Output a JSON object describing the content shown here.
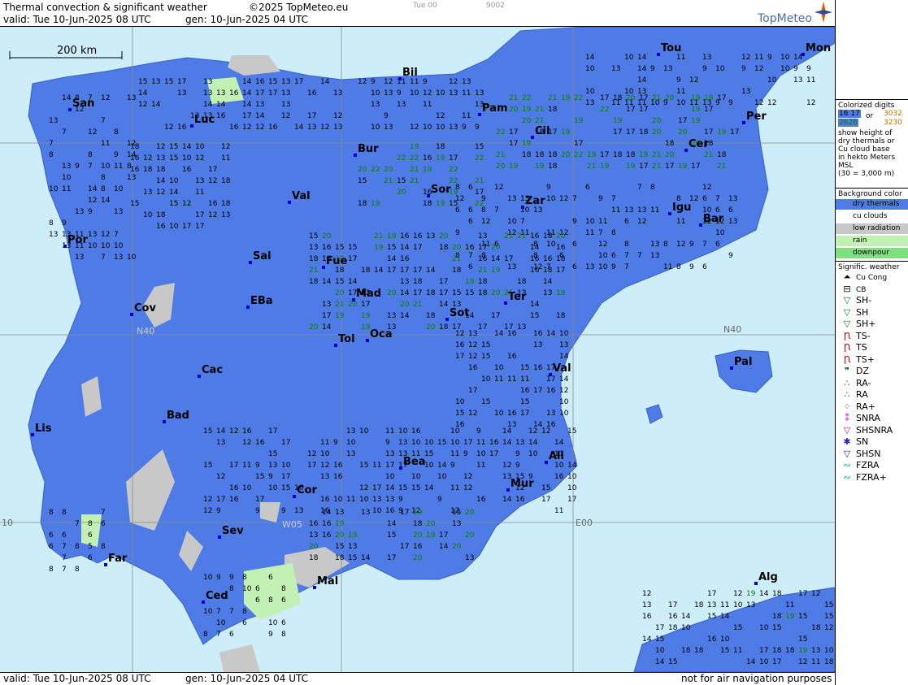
{
  "header": {
    "title": "Thermal convection & significant weather",
    "copyright": "©2025 TopMeteo.eu",
    "step_label": "Tue 00",
    "code": "9002",
    "valid": "valid:  Tue  10-Jun-2025  08 UTC",
    "gen": "gen: 10-Jun-2025 04 UTC"
  },
  "footer": {
    "valid": "valid:  Tue  10-Jun-2025  08 UTC",
    "gen": "gen: 10-Jun-2025 04 UTC",
    "note": "not for air navigation purposes"
  },
  "brand": {
    "name": "TopMeteo"
  },
  "scale_label": "200 km",
  "grid_labels": {
    "n40_left": "N40",
    "n40_right": "N40",
    "w05": "W05",
    "e00": "E00",
    "w10": "10"
  },
  "cities": [
    {
      "name": "San"
    },
    {
      "name": "Luc"
    },
    {
      "name": "Bil"
    },
    {
      "name": "Pam"
    },
    {
      "name": "Tou"
    },
    {
      "name": "Mon"
    },
    {
      "name": "Per"
    },
    {
      "name": "Cil"
    },
    {
      "name": "Bur"
    },
    {
      "name": "Cer"
    },
    {
      "name": "Val"
    },
    {
      "name": "Sor"
    },
    {
      "name": "Zar"
    },
    {
      "name": "Igu"
    },
    {
      "name": "Bar"
    },
    {
      "name": "Por"
    },
    {
      "name": "Sal"
    },
    {
      "name": "Fue"
    },
    {
      "name": "Mad"
    },
    {
      "name": "Cov"
    },
    {
      "name": "EBa"
    },
    {
      "name": "Sot"
    },
    {
      "name": "Ter"
    },
    {
      "name": "Tol"
    },
    {
      "name": "Oca"
    },
    {
      "name": "Pal"
    },
    {
      "name": "Cac"
    },
    {
      "name": "Val"
    },
    {
      "name": "Bad"
    },
    {
      "name": "Lis"
    },
    {
      "name": "Ali"
    },
    {
      "name": "Bea"
    },
    {
      "name": "Cor"
    },
    {
      "name": "Mur"
    },
    {
      "name": "Sev"
    },
    {
      "name": "Far"
    },
    {
      "name": "Mal"
    },
    {
      "name": "Ced"
    },
    {
      "name": "Alg"
    }
  ],
  "legend": {
    "digits_title": "Colorized digits",
    "digits_sample_blue": "16 17",
    "digits_or": "or",
    "digits_sample_orange": "3032",
    "digits_sample_green": "2626",
    "digits_sample_orange2": "3230",
    "digits_desc": [
      "show height of",
      "dry thermals or",
      "Cu cloud base",
      "in hekto Meters",
      "MSL",
      "(30 = 3,000 m)"
    ],
    "bg_title": "Background color",
    "bg_items": [
      {
        "label": "dry thermals",
        "color": "#4f7be6"
      },
      {
        "label": "cu clouds",
        "color": "#ffffff"
      },
      {
        "label": "low radiation",
        "color": "#c8c8c8"
      },
      {
        "label": "rain",
        "color": "#c3f0b4"
      },
      {
        "label": "downpour",
        "color": "#7ee07e"
      }
    ],
    "wx_title": "Signific. weather",
    "wx_items": [
      {
        "label": "Cu Cong",
        "icon": "cu-cong-icon",
        "glyph": "⏶",
        "color": "#000"
      },
      {
        "label": "CB",
        "icon": "cb-icon",
        "glyph": "⊟",
        "color": "#000"
      },
      {
        "label": "SH-",
        "icon": "shower-light-icon",
        "glyph": "▽",
        "color": "#0a7d0a"
      },
      {
        "label": "SH",
        "icon": "shower-icon",
        "glyph": "▽",
        "color": "#0a7d0a"
      },
      {
        "label": "SH+",
        "icon": "shower-heavy-icon",
        "glyph": "▽",
        "color": "#0a7d0a"
      },
      {
        "label": "TS-",
        "icon": "thunderstorm-light-icon",
        "glyph": "Ꞃ",
        "color": "#d00000"
      },
      {
        "label": "TS",
        "icon": "thunderstorm-icon",
        "glyph": "Ꞃ",
        "color": "#d00000"
      },
      {
        "label": "TS+",
        "icon": "thunderstorm-heavy-icon",
        "glyph": "Ꞃ",
        "color": "#d00000"
      },
      {
        "label": "DZ",
        "icon": "drizzle-icon",
        "glyph": "❞",
        "color": "#0a5a0a"
      },
      {
        "label": "RA-",
        "icon": "rain-light-icon",
        "glyph": "∴",
        "color": "#0a5a0a"
      },
      {
        "label": "RA",
        "icon": "rain-icon",
        "glyph": "∴",
        "color": "#0a5a0a"
      },
      {
        "label": "RA+",
        "icon": "rain-heavy-icon",
        "glyph": "⁘",
        "color": "#0a5a0a"
      },
      {
        "label": "SNRA",
        "icon": "snow-rain-icon",
        "glyph": "⁑",
        "color": "#d000d0"
      },
      {
        "label": "SHSNRA",
        "icon": "snow-rain-shower-icon",
        "glyph": "▽",
        "color": "#d000d0"
      },
      {
        "label": "SN",
        "icon": "snow-icon",
        "glyph": "✱",
        "color": "#2020d0"
      },
      {
        "label": "SHSN",
        "icon": "snow-shower-icon",
        "glyph": "▽",
        "color": "#2020d0"
      },
      {
        "label": "FZRA",
        "icon": "freezing-rain-icon",
        "glyph": "∾",
        "color": "#00b0d0"
      },
      {
        "label": "FZRA+",
        "icon": "freezing-rain-heavy-icon",
        "glyph": "∾",
        "color": "#00b0d0"
      }
    ]
  },
  "map_numbers": [
    {
      "t": "9",
      "c": "b"
    },
    {
      "t": "10",
      "c": "b"
    },
    {
      "t": "11",
      "c": "b"
    },
    {
      "t": "12",
      "c": "b"
    },
    {
      "t": "13",
      "c": "b"
    },
    {
      "t": "14",
      "c": "b"
    },
    {
      "t": "15",
      "c": "b"
    },
    {
      "t": "16",
      "c": "b"
    },
    {
      "t": "17",
      "c": "b"
    },
    {
      "t": "18",
      "c": "b"
    },
    {
      "t": "19",
      "c": "g"
    },
    {
      "t": "20",
      "c": "g"
    },
    {
      "t": "21",
      "c": "g"
    },
    {
      "t": "22",
      "c": "g"
    },
    {
      "t": "23",
      "c": "o"
    },
    {
      "t": "24",
      "c": "o"
    },
    {
      "t": "25",
      "c": "o"
    },
    {
      "t": "26",
      "c": "o"
    },
    {
      "t": "8",
      "c": "b"
    },
    {
      "t": "7",
      "c": "b"
    },
    {
      "t": "6",
      "c": "b"
    },
    {
      "t": "5",
      "c": "b"
    }
  ]
}
